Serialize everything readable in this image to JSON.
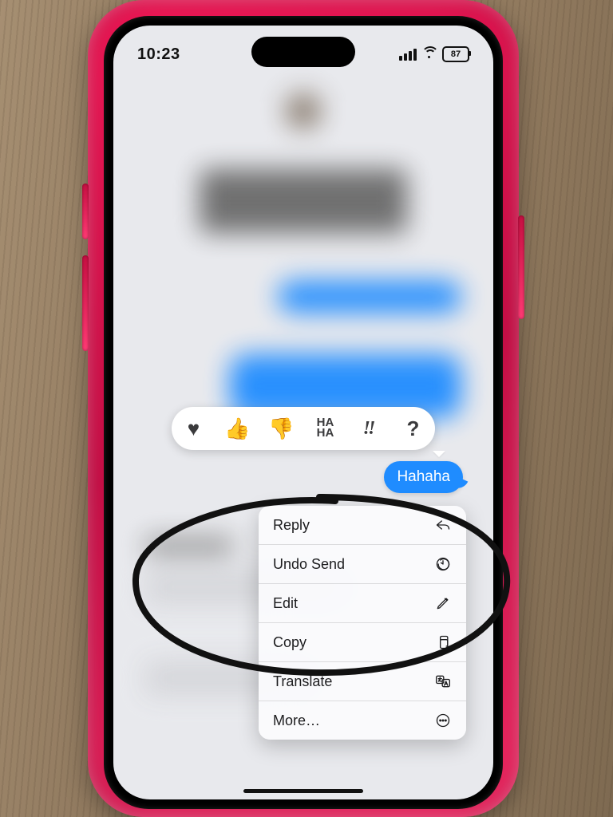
{
  "status": {
    "time": "10:23",
    "battery": "87"
  },
  "tapbacks": {
    "heart": "♥",
    "thumbs_up": "👍",
    "thumbs_down": "👎",
    "haha_top": "HA",
    "haha_bot": "HA",
    "exclaim": "‼",
    "question": "?"
  },
  "selected_message": {
    "text": "Hahaha"
  },
  "menu": {
    "reply": "Reply",
    "undo_send": "Undo Send",
    "edit": "Edit",
    "copy": "Copy",
    "translate": "Translate",
    "more": "More…"
  }
}
